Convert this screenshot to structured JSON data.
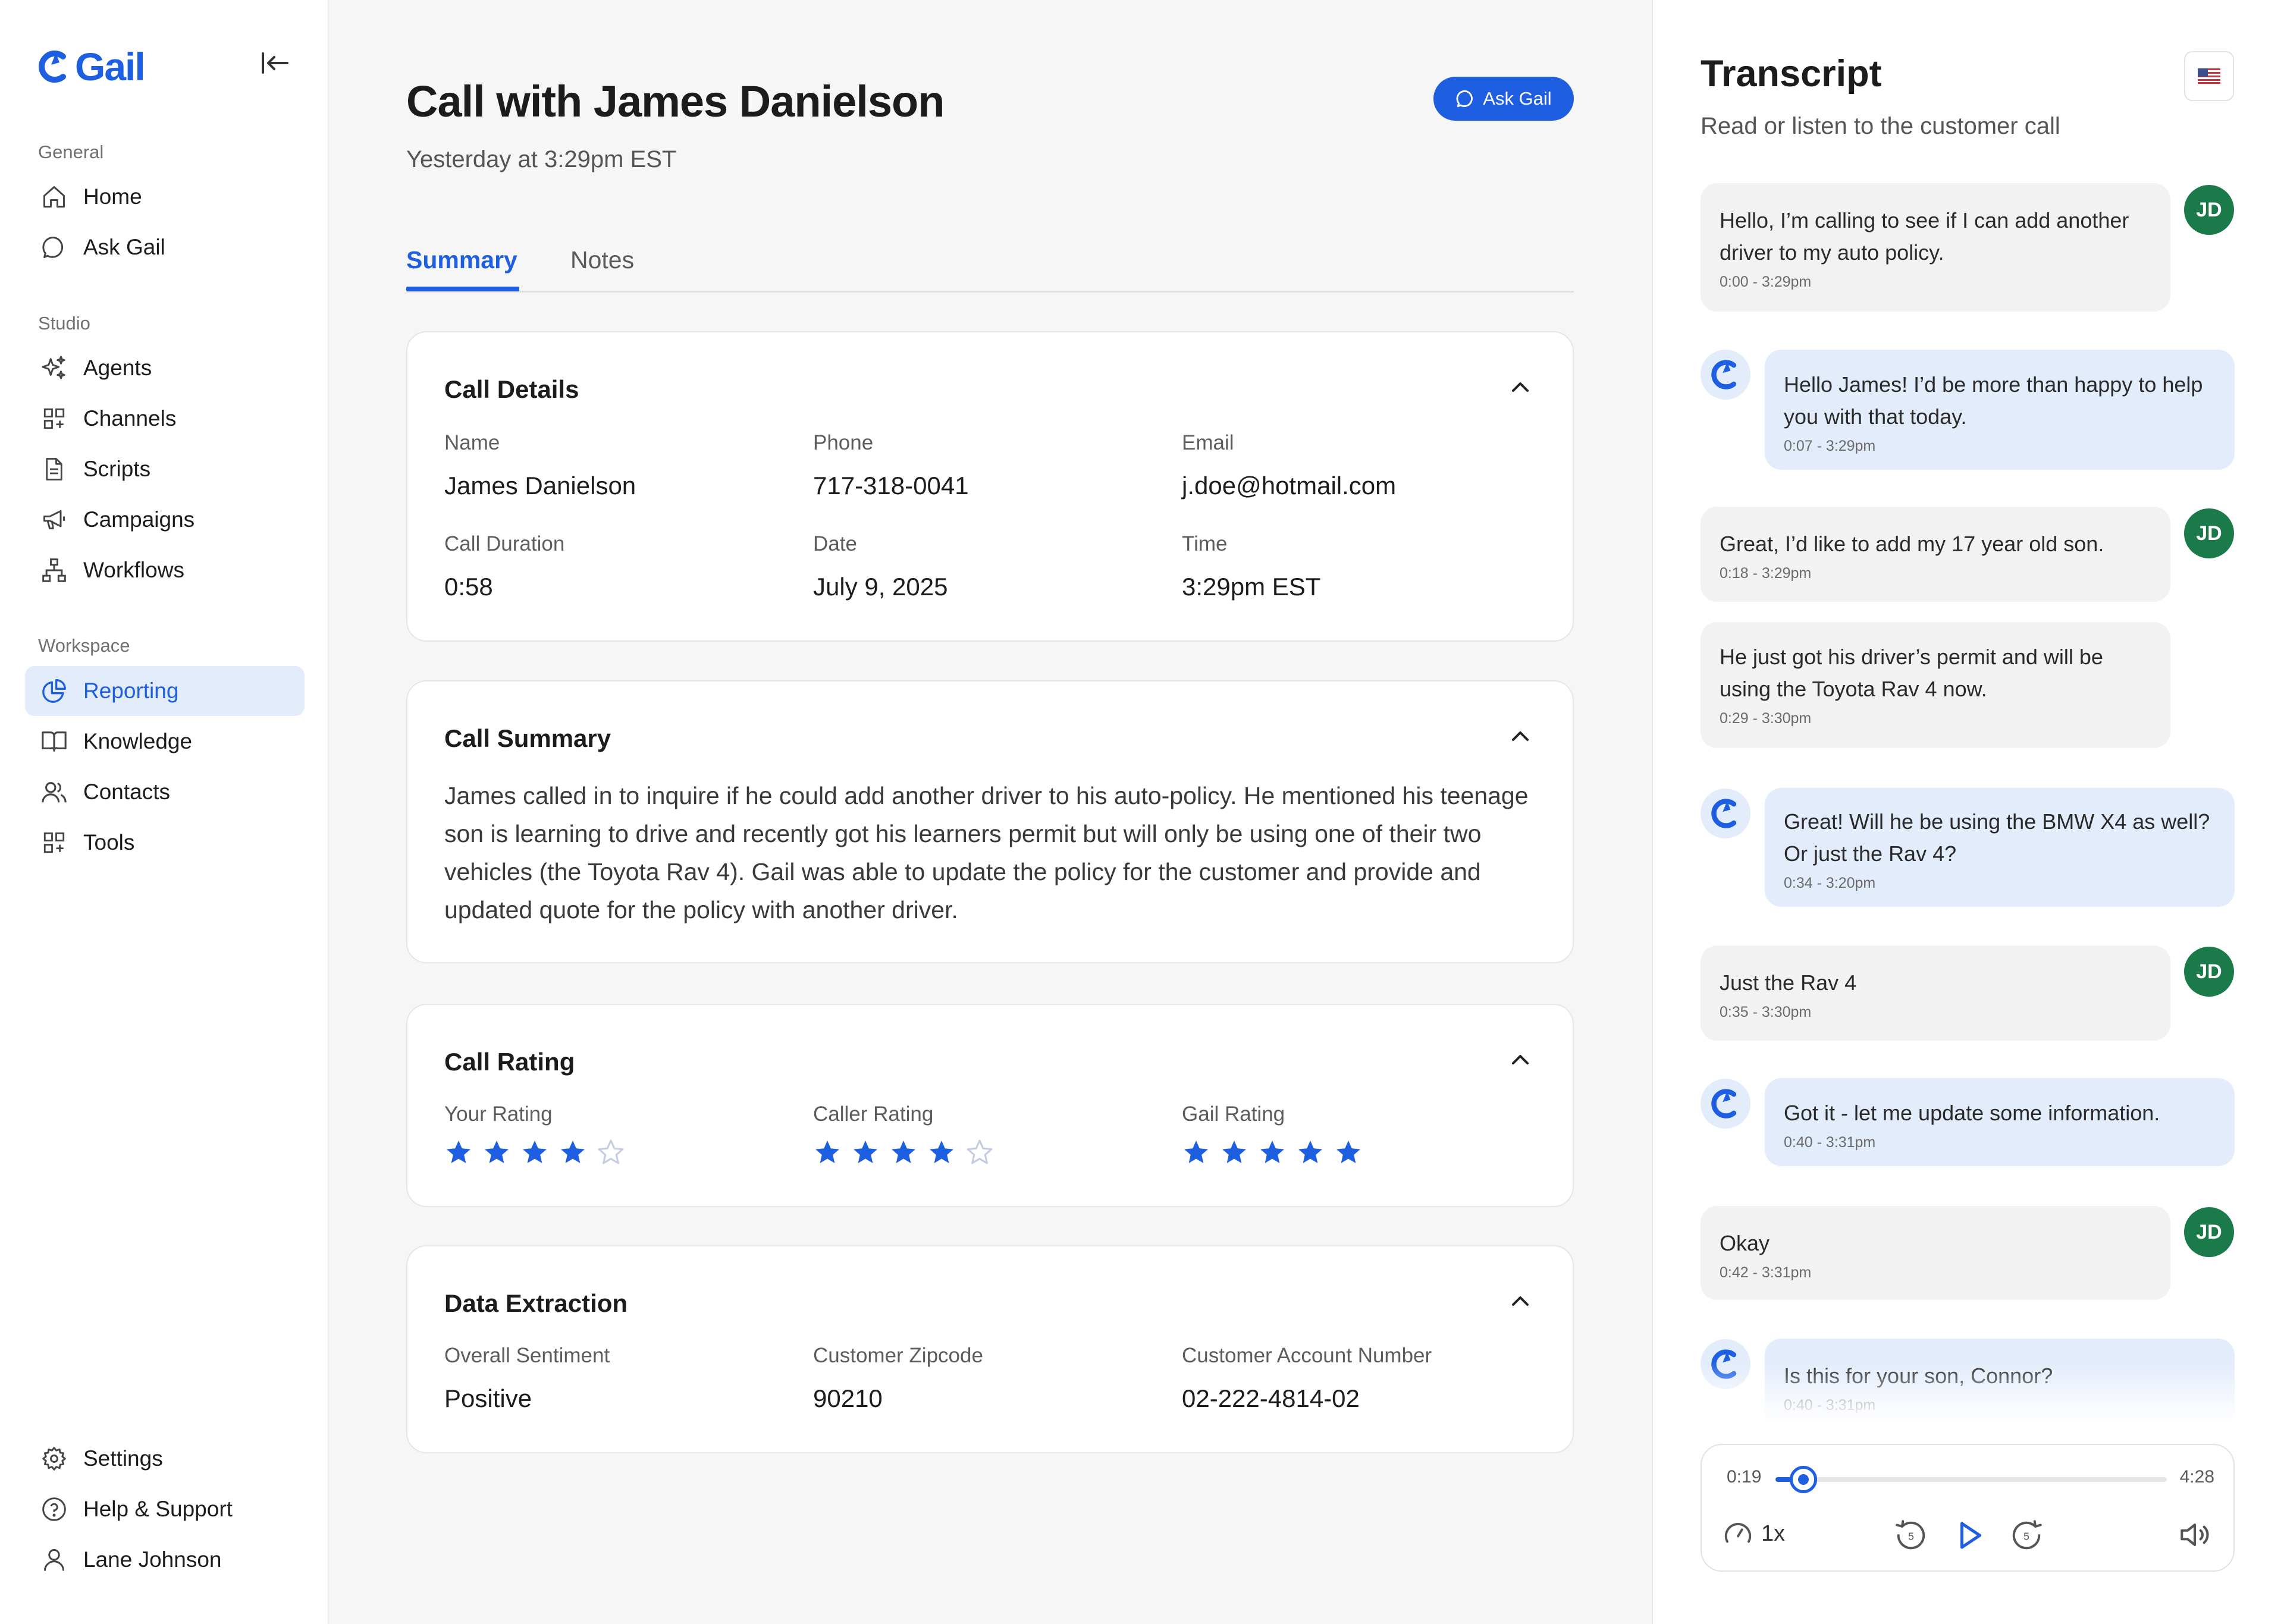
{
  "app": {
    "logo_text": "Gail"
  },
  "sidebar": {
    "sections": [
      {
        "label": "General"
      },
      {
        "label": "Studio"
      },
      {
        "label": "Workspace"
      }
    ],
    "items": [
      {
        "label": "Home",
        "icon": "home-icon"
      },
      {
        "label": "Ask Gail",
        "icon": "chat-bubble-icon"
      },
      {
        "label": "Agents",
        "icon": "sparkles-icon"
      },
      {
        "label": "Channels",
        "icon": "grid-plus-icon"
      },
      {
        "label": "Scripts",
        "icon": "document-icon"
      },
      {
        "label": "Campaigns",
        "icon": "megaphone-icon"
      },
      {
        "label": "Workflows",
        "icon": "workflow-icon"
      },
      {
        "label": "Reporting",
        "icon": "pie-chart-icon",
        "active": true
      },
      {
        "label": "Knowledge",
        "icon": "book-icon"
      },
      {
        "label": "Contacts",
        "icon": "users-icon"
      },
      {
        "label": "Tools",
        "icon": "grid-plus-icon"
      }
    ],
    "footer": [
      {
        "label": "Settings",
        "icon": "gear-icon"
      },
      {
        "label": "Help & Support",
        "icon": "help-icon"
      },
      {
        "label": "Lane Johnson",
        "icon": "user-icon"
      }
    ]
  },
  "header": {
    "title": "Call with James Danielson",
    "subtitle": "Yesterday at 3:29pm EST",
    "ask_button": "Ask Gail"
  },
  "tabs": [
    {
      "label": "Summary",
      "active": true
    },
    {
      "label": "Notes",
      "active": false
    }
  ],
  "call_details": {
    "title": "Call Details",
    "fields": [
      {
        "label": "Name",
        "value": "James Danielson"
      },
      {
        "label": "Phone",
        "value": "717-318-0041"
      },
      {
        "label": "Email",
        "value": "j.doe@hotmail.com"
      },
      {
        "label": "Call Duration",
        "value": "0:58"
      },
      {
        "label": "Date",
        "value": "July 9, 2025"
      },
      {
        "label": "Time",
        "value": "3:29pm EST"
      }
    ]
  },
  "call_summary": {
    "title": "Call Summary",
    "text": "James called in to inquire if he could add another driver to his auto-policy. He mentioned his teenage son is learning to drive and recently got his learners permit but will only be using one of their two vehicles (the Toyota Rav 4). Gail was able to update the policy for the customer and provide and updated quote for the policy with another driver."
  },
  "call_rating": {
    "title": "Call Rating",
    "ratings": [
      {
        "label": "Your Rating",
        "stars": 4,
        "max": 5
      },
      {
        "label": "Caller Rating",
        "stars": 4,
        "max": 5
      },
      {
        "label": "Gail Rating",
        "stars": 5,
        "max": 5
      }
    ]
  },
  "data_extraction": {
    "title": "Data Extraction",
    "fields": [
      {
        "label": "Overall Sentiment",
        "value": "Positive"
      },
      {
        "label": "Customer Zipcode",
        "value": "90210"
      },
      {
        "label": "Customer Account Number",
        "value": "02-222-4814-02"
      }
    ]
  },
  "transcript": {
    "title": "Transcript",
    "subtitle": "Read or listen to the customer call",
    "language_flag": "us-flag-icon",
    "user_initials": "JD",
    "messages": [
      {
        "speaker": "user",
        "text": "Hello, I’m calling to see if I can add another driver to my auto policy.",
        "time": "0:00 - 3:29pm"
      },
      {
        "speaker": "agent",
        "text": "Hello James! I’d be more than happy to help you with that today.",
        "time": "0:07 - 3:29pm"
      },
      {
        "speaker": "user",
        "text": "Great, I’d like to add my 17 year old son.",
        "time": "0:18 - 3:29pm"
      },
      {
        "speaker": "user",
        "text": "He just got his driver’s permit and will be using the Toyota Rav 4 now.",
        "time": "0:29 - 3:30pm"
      },
      {
        "speaker": "agent",
        "text": "Great! Will he be using the BMW X4 as well? Or just the Rav 4?",
        "time": "0:34 - 3:20pm"
      },
      {
        "speaker": "user",
        "text": "Just the Rav 4",
        "time": "0:35 - 3:30pm"
      },
      {
        "speaker": "agent",
        "text": "Got it - let me update some information.",
        "time": "0:40 - 3:31pm"
      },
      {
        "speaker": "user",
        "text": "Okay",
        "time": "0:42 - 3:31pm"
      },
      {
        "speaker": "agent",
        "text": "Is this for your son, Connor?",
        "time": "0:40 - 3:31pm"
      }
    ]
  },
  "player": {
    "current_time": "0:19",
    "total_time": "4:28",
    "progress": 0.071,
    "speed": "1x",
    "skip_seconds": "5"
  },
  "colors": {
    "accent": "#1d5fe0",
    "active_bg": "#e3ecfb",
    "avatar_green": "#1b7a4a",
    "star_empty": "#c3cce0"
  }
}
